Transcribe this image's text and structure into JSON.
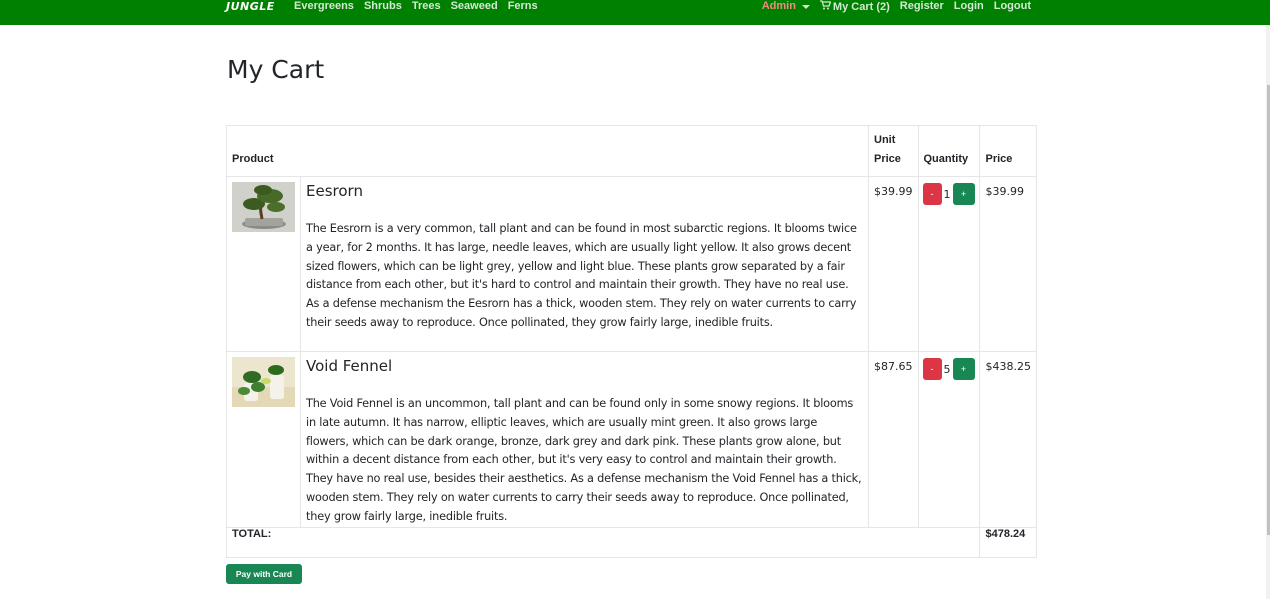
{
  "navbar": {
    "brand": "JUNGLE",
    "links": [
      "Evergreens",
      "Shrubs",
      "Trees",
      "Seaweed",
      "Ferns"
    ],
    "admin_label": "Admin",
    "cart_label": "My Cart (2)",
    "register_label": "Register",
    "login_label": "Login",
    "logout_label": "Logout",
    "bg_color": "#008000"
  },
  "page": {
    "title": "My Cart"
  },
  "table": {
    "headers": {
      "product": "Product",
      "unit_price": "Unit Price",
      "quantity": "Quantity",
      "price": "Price"
    },
    "items": [
      {
        "image": "bonsai-tree-image",
        "name": "Eesrorn",
        "description": "The Eesrorn is a very common, tall plant and can be found in most subarctic regions. It blooms twice a year, for 2 months. It has large, needle leaves, which are usually light yellow. It also grows decent sized flowers, which can be light grey, yellow and light blue. These plants grow separated by a fair distance from each other, but it's hard to control and maintain their growth. They have no real use. As a defense mechanism the Eesrorn has a thick, wooden stem. They rely on water currents to carry their seeds away to reproduce. Once pollinated, they grow fairly large, inedible fruits.",
        "unit_price": "$39.99",
        "quantity": "1",
        "price": "$39.99"
      },
      {
        "image": "potted-plant-image",
        "name": "Void Fennel",
        "description": "The Void Fennel is an uncommon, tall plant and can be found only in some snowy regions. It blooms in late autumn. It has narrow, elliptic leaves, which are usually mint green. It also grows large flowers, which can be dark orange, bronze, dark grey and dark pink. These plants grow alone, but within a decent distance from each other, but it's very easy to control and maintain their growth. They have no real use, besides their aesthetics. As a defense mechanism the Void Fennel has a thick, wooden stem. They rely on water currents to carry their seeds away to reproduce. Once pollinated, they grow fairly large, inedible fruits.",
        "unit_price": "$87.65",
        "quantity": "5",
        "price": "$438.25"
      }
    ],
    "minus_label": "-",
    "plus_label": "+",
    "total_label": "TOTAL:",
    "total_value": "$478.24"
  },
  "pay_button": "Pay with Card",
  "colors": {
    "minus": "#dc3545",
    "plus": "#198754",
    "pay": "#198754"
  }
}
